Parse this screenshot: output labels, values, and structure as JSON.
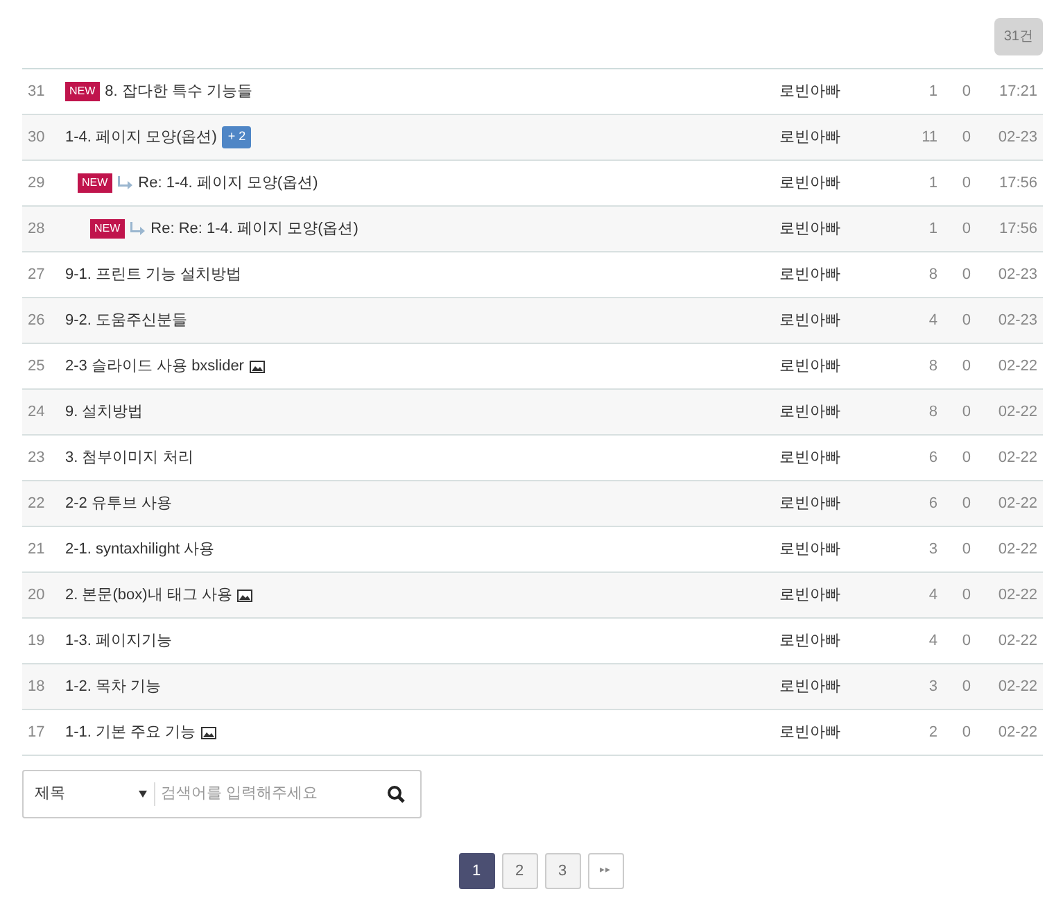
{
  "total_badge": "31건",
  "posts": [
    {
      "number": "31",
      "title": "8. 잡다한 특수 기능들",
      "new_badge": "NEW",
      "has_image": false,
      "author": "로빈아빠",
      "views": "1",
      "votes": "0",
      "date": "17:21"
    },
    {
      "number": "30",
      "title": "1-4. 페이지 모양(옵션)",
      "comment_count": "+ 2",
      "has_image": false,
      "author": "로빈아빠",
      "views": "11",
      "votes": "0",
      "date": "02-23",
      "children": [
        {
          "number": "29",
          "title": "Re: 1-4. 페이지 모양(옵션)",
          "new_badge": "NEW",
          "has_image": false,
          "author": "로빈아빠",
          "views": "1",
          "votes": "0",
          "date": "17:56",
          "children": [
            {
              "number": "28",
              "title": "Re: Re: 1-4. 페이지 모양(옵션)",
              "new_badge": "NEW",
              "has_image": false,
              "author": "로빈아빠",
              "views": "1",
              "votes": "0",
              "date": "17:56"
            }
          ]
        }
      ]
    },
    {
      "number": "27",
      "title": "9-1. 프린트 기능 설치방법",
      "has_image": false,
      "author": "로빈아빠",
      "views": "8",
      "votes": "0",
      "date": "02-23"
    },
    {
      "number": "26",
      "title": "9-2. 도움주신분들",
      "has_image": false,
      "author": "로빈아빠",
      "views": "4",
      "votes": "0",
      "date": "02-23"
    },
    {
      "number": "25",
      "title": "2-3 슬라이드 사용 bxslider",
      "has_image": true,
      "author": "로빈아빠",
      "views": "8",
      "votes": "0",
      "date": "02-22"
    },
    {
      "number": "24",
      "title": "9. 설치방법",
      "has_image": false,
      "author": "로빈아빠",
      "views": "8",
      "votes": "0",
      "date": "02-22"
    },
    {
      "number": "23",
      "title": "3. 첨부이미지 처리",
      "has_image": false,
      "author": "로빈아빠",
      "views": "6",
      "votes": "0",
      "date": "02-22"
    },
    {
      "number": "22",
      "title": "2-2 유투브 사용",
      "has_image": false,
      "author": "로빈아빠",
      "views": "6",
      "votes": "0",
      "date": "02-22"
    },
    {
      "number": "21",
      "title": "2-1. syntaxhilight 사용",
      "has_image": false,
      "author": "로빈아빠",
      "views": "3",
      "votes": "0",
      "date": "02-22"
    },
    {
      "number": "20",
      "title": "2. 본문(box)내 태그 사용",
      "has_image": true,
      "author": "로빈아빠",
      "views": "4",
      "votes": "0",
      "date": "02-22"
    },
    {
      "number": "19",
      "title": "1-3. 페이지기능",
      "has_image": false,
      "author": "로빈아빠",
      "views": "4",
      "votes": "0",
      "date": "02-22"
    },
    {
      "number": "18",
      "title": "1-2. 목차 기능",
      "has_image": false,
      "author": "로빈아빠",
      "views": "3",
      "votes": "0",
      "date": "02-22"
    },
    {
      "number": "17",
      "title": "1-1. 기본 주요 기능",
      "has_image": true,
      "author": "로빈아빠",
      "views": "2",
      "votes": "0",
      "date": "02-22"
    }
  ],
  "search": {
    "field_select": "제목",
    "placeholder": "검색어를 입력해주세요"
  },
  "pagination": {
    "pages": [
      {
        "label": "1",
        "selected": true
      },
      {
        "label": "2",
        "selected": false
      },
      {
        "label": "3",
        "selected": false
      }
    ],
    "last_label": "▸▸"
  }
}
